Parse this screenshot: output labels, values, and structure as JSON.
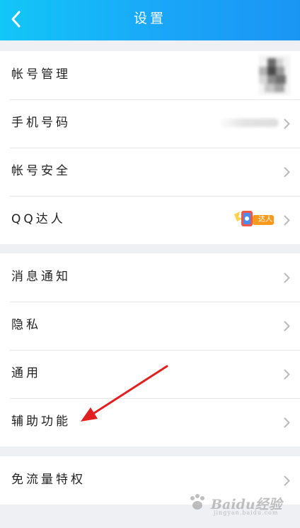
{
  "header": {
    "title": "设置",
    "back_icon": "chevron-left-icon"
  },
  "groups": [
    {
      "items": [
        {
          "label": "帐号管理",
          "accessory": "avatar-thumbnail"
        },
        {
          "label": "手机号码",
          "accessory": "masked-phone"
        },
        {
          "label": "帐号安全",
          "accessory": "chevron-right-icon"
        },
        {
          "label": "QQ达人",
          "accessory": "qq-daren-badge",
          "badge_text": "达人"
        }
      ]
    },
    {
      "items": [
        {
          "label": "消息通知"
        },
        {
          "label": "隐私"
        },
        {
          "label": "通用"
        },
        {
          "label": "辅助功能"
        }
      ]
    },
    {
      "items": [
        {
          "label": "免流量特权"
        }
      ]
    }
  ],
  "annotation": {
    "type": "red-arrow",
    "target": "辅助功能",
    "color": "#e02020"
  },
  "watermark": {
    "brand": "Baidu经验",
    "url": "jingyan.baidu.com"
  },
  "colors": {
    "header_start": "#12c6f7",
    "header_end": "#1a95f4",
    "background": "#eff0f4",
    "chevron": "#b9b9b9"
  }
}
